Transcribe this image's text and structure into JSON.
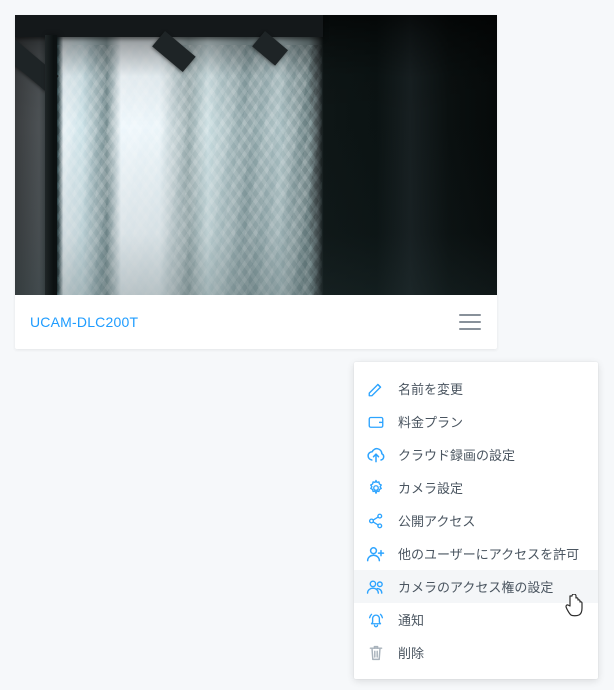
{
  "camera": {
    "name": "UCAM-DLC200T"
  },
  "menu": {
    "items": [
      {
        "id": "rename",
        "label": "名前を変更",
        "icon": "pencil-icon"
      },
      {
        "id": "pricing",
        "label": "料金プラン",
        "icon": "wallet-icon"
      },
      {
        "id": "cloud-rec",
        "label": "クラウド録画の設定",
        "icon": "cloud-upload-icon"
      },
      {
        "id": "camera-set",
        "label": "カメラ設定",
        "icon": "gear-icon"
      },
      {
        "id": "public-access",
        "label": "公開アクセス",
        "icon": "share-icon"
      },
      {
        "id": "grant-access",
        "label": "他のユーザーにアクセスを許可",
        "icon": "user-plus-icon"
      },
      {
        "id": "access-rights",
        "label": "カメラのアクセス権の設定",
        "icon": "users-icon"
      },
      {
        "id": "notifications",
        "label": "通知",
        "icon": "bell-icon"
      },
      {
        "id": "delete",
        "label": "削除",
        "icon": "trash-icon"
      }
    ],
    "hovered_id": "access-rights"
  },
  "colors": {
    "accent": "#1e9cff",
    "icon": "#2da4ff",
    "muted": "#a9b3bc"
  }
}
